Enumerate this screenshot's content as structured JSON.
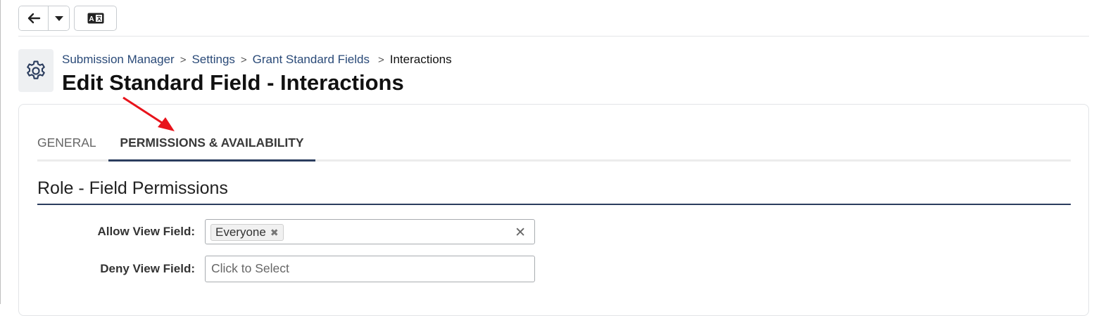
{
  "toolbar": {
    "back_icon": "arrow-left-icon",
    "caret_icon": "caret-down-icon",
    "translate_icon": "translate-icon"
  },
  "header": {
    "icon": "gear-icon",
    "breadcrumb": [
      "Submission Manager",
      "Settings",
      "Grant Standard Fields",
      "Interactions"
    ],
    "title": "Edit Standard Field - Interactions"
  },
  "tabs": [
    {
      "label": "GENERAL",
      "active": false
    },
    {
      "label": "PERMISSIONS & AVAILABILITY",
      "active": true
    }
  ],
  "section": {
    "title": "Role - Field Permissions"
  },
  "fields": {
    "allow_view": {
      "label": "Allow View Field:",
      "selected": [
        "Everyone"
      ]
    },
    "deny_view": {
      "label": "Deny View Field:",
      "placeholder": "Click to Select"
    }
  },
  "colors": {
    "accent": "#2b3d5e",
    "link": "#2a4a78",
    "annotation_arrow": "#e8131b"
  }
}
